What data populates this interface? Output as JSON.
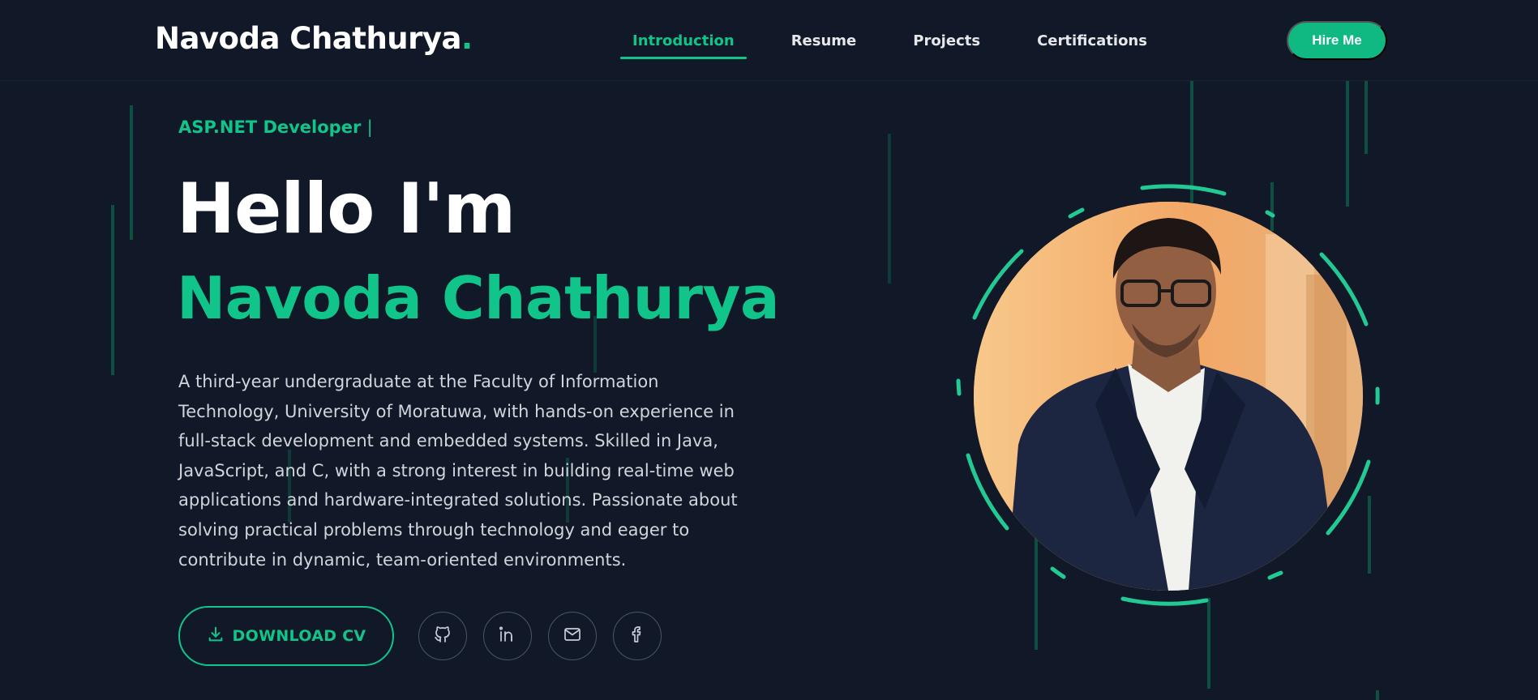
{
  "header": {
    "logo_text": "Navoda Chathurya",
    "logo_dot": ".",
    "nav": [
      {
        "label": "Introduction",
        "active": true
      },
      {
        "label": "Resume",
        "active": false
      },
      {
        "label": "Projects",
        "active": false
      },
      {
        "label": "Certifications",
        "active": false
      }
    ],
    "hire_label": "Hire Me"
  },
  "hero": {
    "role": "ASP.NET Developer",
    "cursor": "|",
    "greeting": "Hello I'm",
    "name": "Navoda Chathurya",
    "bio": "A third-year undergraduate at the Faculty of Information Technology, University of Moratuwa, with hands-on experience in full-stack development and embedded systems. Skilled in Java, JavaScript, and C, with a strong interest in building real-time web applications and hardware-integrated solutions. Passionate about solving practical problems through technology and eager to contribute in dynamic, team-oriented environments.",
    "download_label": "DOWNLOAD CV",
    "social": [
      "github-icon",
      "linkedin-icon",
      "mail-icon",
      "facebook-icon"
    ]
  },
  "colors": {
    "background": "#111827",
    "accent": "#10c48a",
    "text": "#ffffff",
    "muted_text": "#d1d5db"
  }
}
